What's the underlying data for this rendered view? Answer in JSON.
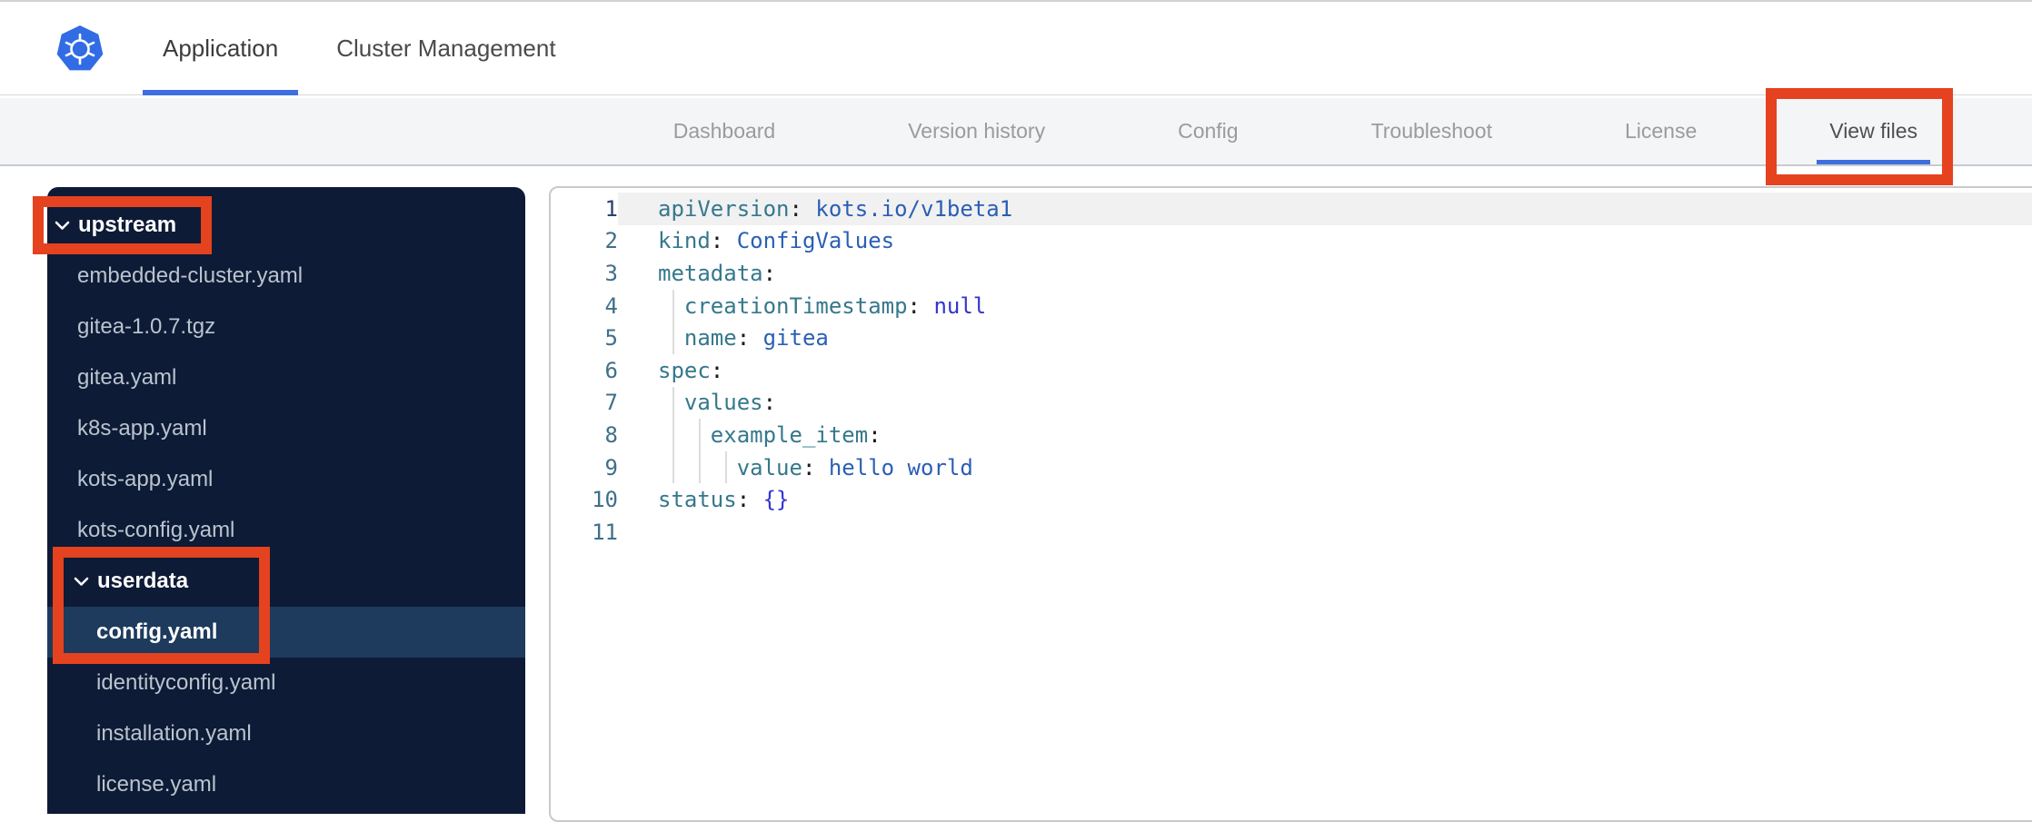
{
  "topbar": {
    "logo": "kubernetes-logo",
    "active_tab": "Application",
    "tabs": [
      {
        "label": "Application"
      },
      {
        "label": "Cluster Management"
      }
    ]
  },
  "subnav": {
    "active_tab": "View files",
    "tabs": [
      {
        "label": "Dashboard"
      },
      {
        "label": "Version history"
      },
      {
        "label": "Config"
      },
      {
        "label": "Troubleshoot"
      },
      {
        "label": "License"
      },
      {
        "label": "View files"
      }
    ]
  },
  "file_tree": {
    "items": [
      {
        "label": "upstream",
        "type": "folder",
        "level": 1,
        "expanded": true
      },
      {
        "label": "embedded-cluster.yaml",
        "type": "file",
        "level": 1
      },
      {
        "label": "gitea-1.0.7.tgz",
        "type": "file",
        "level": 1
      },
      {
        "label": "gitea.yaml",
        "type": "file",
        "level": 1
      },
      {
        "label": "k8s-app.yaml",
        "type": "file",
        "level": 1
      },
      {
        "label": "kots-app.yaml",
        "type": "file",
        "level": 1
      },
      {
        "label": "kots-config.yaml",
        "type": "file",
        "level": 1
      },
      {
        "label": "userdata",
        "type": "folder",
        "level": 2,
        "expanded": true
      },
      {
        "label": "config.yaml",
        "type": "file",
        "level": 2,
        "selected": true
      },
      {
        "label": "identityconfig.yaml",
        "type": "file",
        "level": 2
      },
      {
        "label": "installation.yaml",
        "type": "file",
        "level": 2
      },
      {
        "label": "license.yaml",
        "type": "file",
        "level": 2
      }
    ]
  },
  "editor": {
    "lines": [
      {
        "num": "1",
        "indent": 0,
        "active": true,
        "tokens": [
          [
            "k",
            "apiVersion"
          ],
          [
            "p",
            ":"
          ],
          [
            "t",
            " "
          ],
          [
            "v",
            "kots.io/v1beta1"
          ]
        ]
      },
      {
        "num": "2",
        "indent": 0,
        "tokens": [
          [
            "k",
            "kind"
          ],
          [
            "p",
            ":"
          ],
          [
            "t",
            " "
          ],
          [
            "v",
            "ConfigValues"
          ]
        ]
      },
      {
        "num": "3",
        "indent": 0,
        "tokens": [
          [
            "k",
            "metadata"
          ],
          [
            "p",
            ":"
          ]
        ]
      },
      {
        "num": "4",
        "indent": 2,
        "tokens": [
          [
            "t",
            "  "
          ],
          [
            "k",
            "creationTimestamp"
          ],
          [
            "p",
            ":"
          ],
          [
            "t",
            " "
          ],
          [
            "c",
            "null"
          ]
        ]
      },
      {
        "num": "5",
        "indent": 2,
        "tokens": [
          [
            "t",
            "  "
          ],
          [
            "k",
            "name"
          ],
          [
            "p",
            ":"
          ],
          [
            "t",
            " "
          ],
          [
            "v",
            "gitea"
          ]
        ]
      },
      {
        "num": "6",
        "indent": 0,
        "tokens": [
          [
            "k",
            "spec"
          ],
          [
            "p",
            ":"
          ]
        ]
      },
      {
        "num": "7",
        "indent": 2,
        "tokens": [
          [
            "t",
            "  "
          ],
          [
            "k",
            "values"
          ],
          [
            "p",
            ":"
          ]
        ]
      },
      {
        "num": "8",
        "indent": 4,
        "tokens": [
          [
            "t",
            "    "
          ],
          [
            "k",
            "example_item"
          ],
          [
            "p",
            ":"
          ]
        ]
      },
      {
        "num": "9",
        "indent": 6,
        "tokens": [
          [
            "t",
            "      "
          ],
          [
            "k",
            "value"
          ],
          [
            "p",
            ":"
          ],
          [
            "t",
            " "
          ],
          [
            "v",
            "hello world"
          ]
        ]
      },
      {
        "num": "10",
        "indent": 0,
        "tokens": [
          [
            "k",
            "status"
          ],
          [
            "p",
            ":"
          ],
          [
            "t",
            " "
          ],
          [
            "c",
            "{}"
          ]
        ]
      },
      {
        "num": "11",
        "indent": 0,
        "tokens": []
      }
    ]
  },
  "annotations": {
    "color": "#E5421F",
    "boxes": [
      "view-files-tab",
      "upstream-folder",
      "userdata-and-config-yaml"
    ]
  },
  "colors": {
    "accent_blue": "#3E6EE0",
    "kubernetes_blue": "#326CE5",
    "sidebar_bg": "#0E1B36",
    "sidebar_selected_bg": "#1E3A5C",
    "yaml_key": "#35788C",
    "yaml_value": "#2A5FB4",
    "yaml_constant": "#3434CE"
  }
}
